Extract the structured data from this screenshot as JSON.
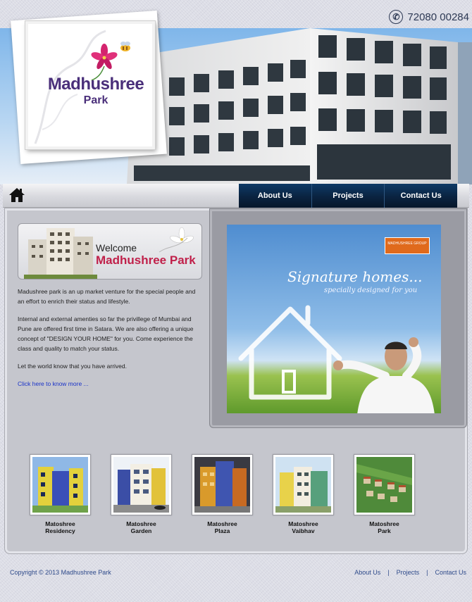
{
  "header": {
    "phone": "72080 00284",
    "phone_icon": "phone-icon"
  },
  "logo": {
    "title": "Madhushree",
    "subtitle": "Park"
  },
  "nav": {
    "home_icon": "home-icon",
    "items": [
      {
        "label": "About Us"
      },
      {
        "label": "Projects"
      },
      {
        "label": "Contact Us"
      }
    ]
  },
  "welcome": {
    "label": "Welcome",
    "name": "Madhushree Park"
  },
  "intro": {
    "paragraphs": [
      "Madushree park is an up market venture for the special people and an effort to enrich their status and lifestyle.",
      "Internal and external amenties so far the privillege of Mumbai and Pune are offered first time in Satara. We are also offering a unique concept of \"DESIGN YOUR HOME\" for you. Come experience the class and quality to match your status.",
      "Let the world know that you have arrived."
    ],
    "more_link": "Click here to know more ..."
  },
  "ad": {
    "title": "Signature homes...",
    "subtitle": "specially designed for you",
    "badge": "MADHUSHREE GROUP"
  },
  "projects": [
    {
      "line1": "Matoshree",
      "line2": "Residency"
    },
    {
      "line1": "Matoshree",
      "line2": "Garden"
    },
    {
      "line1": "Matoshree",
      "line2": "Plaza"
    },
    {
      "line1": "Matoshree",
      "line2": "Vaibhav"
    },
    {
      "line1": "Matoshree",
      "line2": "Park"
    }
  ],
  "footer": {
    "copyright": "Copyright © 2013 Madhushree Park",
    "links": [
      "About Us",
      "Projects",
      "Contact Us"
    ],
    "separator": "|"
  },
  "colors": {
    "nav_bg": "#0a2340",
    "accent_pink": "#c0204a",
    "logo_purple": "#4a2f7a",
    "link_blue": "#1a33c8"
  }
}
